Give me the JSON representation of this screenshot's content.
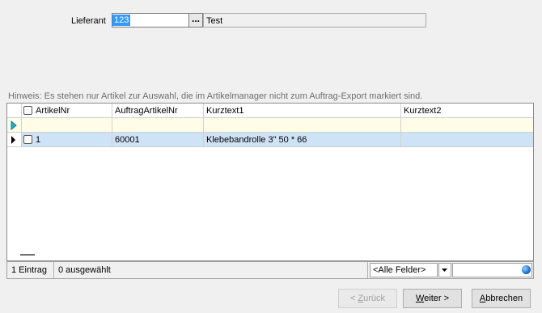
{
  "supplier": {
    "label": "Lieferant",
    "number": "123",
    "browse_label": "...",
    "name": "Test"
  },
  "hint": "Hinweis: Es stehen nur Artikel zur Auswahl, die im Artikelmanager nicht zum Auftrag-Export markiert sind.",
  "grid": {
    "columns": [
      "ArtikelNr",
      "AuftragArtikelNr",
      "Kurztext1",
      "Kurztext2"
    ],
    "rows": [
      {
        "artikelnr": "1",
        "auftragartikelnr": "60001",
        "kurztext1": "Klebebandrolle 3\" 50 * 66",
        "kurztext2": ""
      }
    ]
  },
  "status": {
    "count": "1 Eintrag",
    "selected": "0 ausgewählt",
    "filter_field": "<Alle Felder>"
  },
  "buttons": {
    "back_prefix": "< ",
    "back_accel": "Z",
    "back_rest": "urück",
    "next_accel": "W",
    "next_rest": "eiter >",
    "cancel_accel": "A",
    "cancel_rest": "bbrechen"
  }
}
